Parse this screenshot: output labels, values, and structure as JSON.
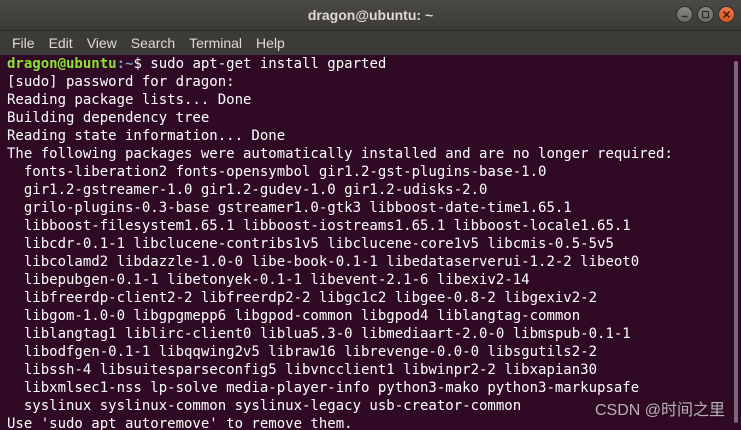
{
  "window": {
    "title": "dragon@ubuntu: ~",
    "buttons": {
      "minimize": "minimize-icon",
      "maximize": "maximize-icon",
      "close": "close-icon"
    }
  },
  "menu": [
    "File",
    "Edit",
    "View",
    "Search",
    "Terminal",
    "Help"
  ],
  "terminal": {
    "prompt_user": "dragon@ubuntu",
    "prompt_path": ":~",
    "prompt_suffix": "$ ",
    "command": "sudo apt-get install gparted",
    "lines": [
      "[sudo] password for dragon:",
      "Reading package lists... Done",
      "Building dependency tree",
      "Reading state information... Done",
      "The following packages were automatically installed and are no longer required:",
      "  fonts-liberation2 fonts-opensymbol gir1.2-gst-plugins-base-1.0",
      "  gir1.2-gstreamer-1.0 gir1.2-gudev-1.0 gir1.2-udisks-2.0",
      "  grilo-plugins-0.3-base gstreamer1.0-gtk3 libboost-date-time1.65.1",
      "  libboost-filesystem1.65.1 libboost-iostreams1.65.1 libboost-locale1.65.1",
      "  libcdr-0.1-1 libclucene-contribs1v5 libclucene-core1v5 libcmis-0.5-5v5",
      "  libcolamd2 libdazzle-1.0-0 libe-book-0.1-1 libedataserverui-1.2-2 libeot0",
      "  libepubgen-0.1-1 libetonyek-0.1-1 libevent-2.1-6 libexiv2-14",
      "  libfreerdp-client2-2 libfreerdp2-2 libgc1c2 libgee-0.8-2 libgexiv2-2",
      "  libgom-1.0-0 libgpgmepp6 libgpod-common libgpod4 liblangtag-common",
      "  liblangtag1 liblirc-client0 liblua5.3-0 libmediaart-2.0-0 libmspub-0.1-1",
      "  libodfgen-0.1-1 libqqwing2v5 libraw16 librevenge-0.0-0 libsgutils2-2",
      "  libssh-4 libsuitesparseconfig5 libvncclient1 libwinpr2-2 libxapian30",
      "  libxmlsec1-nss lp-solve media-player-info python3-mako python3-markupsafe",
      "  syslinux syslinux-common syslinux-legacy usb-creator-common",
      "Use 'sudo apt autoremove' to remove them."
    ]
  },
  "watermark": "CSDN @时间之里",
  "colors": {
    "terminal_bg": "#300a24",
    "prompt_user": "#8ae234",
    "prompt_path": "#729fcf",
    "chrome": "#3c3b37",
    "close_button": "#e95420"
  }
}
